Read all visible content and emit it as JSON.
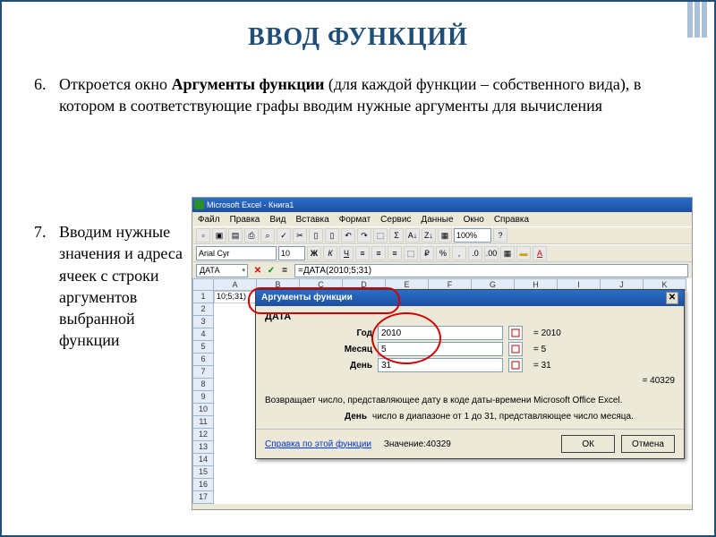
{
  "title": "ВВОД ФУНКЦИЙ",
  "items": {
    "six": {
      "num": "6.",
      "text_a": "Откроется окно ",
      "bold": "Аргументы функции",
      "text_b": " (для каждой функции – собственного вида), в котором в соответствующие графы вводим нужные аргументы для вычисления"
    },
    "seven": {
      "num": "7.",
      "text": "Вводим нужные значения и адреса ячеек с строки аргументов выбранной функции"
    }
  },
  "excel": {
    "title": "Microsoft Excel - Книга1",
    "menu": [
      "Файл",
      "Правка",
      "Вид",
      "Вставка",
      "Формат",
      "Сервис",
      "Данные",
      "Окно",
      "Справка"
    ],
    "font": "Arial Cyr",
    "fontsize": "10",
    "zoom": "100%",
    "namebox": "ДАТА",
    "formula": "=ДАТА(2010;5;31)",
    "cols": [
      "",
      "A",
      "B",
      "C",
      "D",
      "E",
      "F",
      "G",
      "H",
      "I",
      "J",
      "K"
    ],
    "rows": [
      "1",
      "2",
      "3",
      "4",
      "5",
      "6",
      "7",
      "8",
      "9",
      "10",
      "11",
      "12",
      "13",
      "14",
      "15",
      "16",
      "17"
    ],
    "cell_a1": "10;5;31)",
    "fx_x": "✕",
    "fx_v": "✓",
    "fx_eq": "="
  },
  "dialog": {
    "title": "Аргументы функции",
    "close": "✕",
    "funcname": "ДАТА",
    "fields": [
      {
        "label": "Год",
        "value": "2010",
        "result": "= 2010"
      },
      {
        "label": "Месяц",
        "value": "5",
        "result": "= 5"
      },
      {
        "label": "День",
        "value": "31",
        "result": "= 31"
      }
    ],
    "calc_result": "= 40329",
    "desc": "Возвращает число, представляющее дату в коде даты-времени Microsoft Office Excel.",
    "param_name": "День",
    "param_desc": "число в диапазоне от 1 до 31, представляющее число месяца.",
    "help": "Справка по этой функции",
    "value_label": "Значение:40329",
    "ok": "ОК",
    "cancel": "Отмена"
  }
}
